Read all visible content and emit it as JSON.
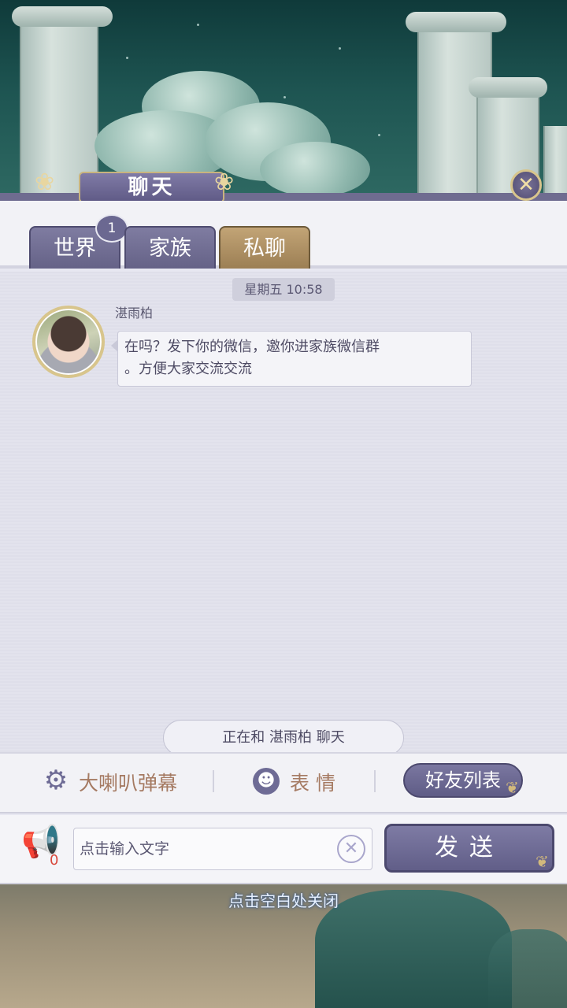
{
  "panel": {
    "title": "聊天",
    "close_icon": "close-icon"
  },
  "tabs": [
    {
      "label": "世界",
      "active": false,
      "badge": "1"
    },
    {
      "label": "家族",
      "active": false
    },
    {
      "label": "私聊",
      "active": true
    }
  ],
  "messages": {
    "timestamp": "星期五 10:58",
    "sender": "湛雨柏",
    "text_line1": "在吗？发下你的微信，邀你进家族微信群",
    "text_line2": "。方便大家交流交流"
  },
  "chat_status": "正在和 湛雨柏 聊天",
  "actions": {
    "danmu_label": "大喇叭弹幕",
    "emoji_label": "表情",
    "friends_label": "好友列表"
  },
  "input": {
    "horn_count": "0",
    "placeholder": "点击输入文字",
    "value": "",
    "send_label": "发送"
  },
  "footer": {
    "close_hint": "点击空白处关闭"
  },
  "colors": {
    "accent": "#6f6c90",
    "active_tab": "#b39568",
    "gold_trim": "#d8c58c",
    "warm_text": "#a57a62"
  }
}
